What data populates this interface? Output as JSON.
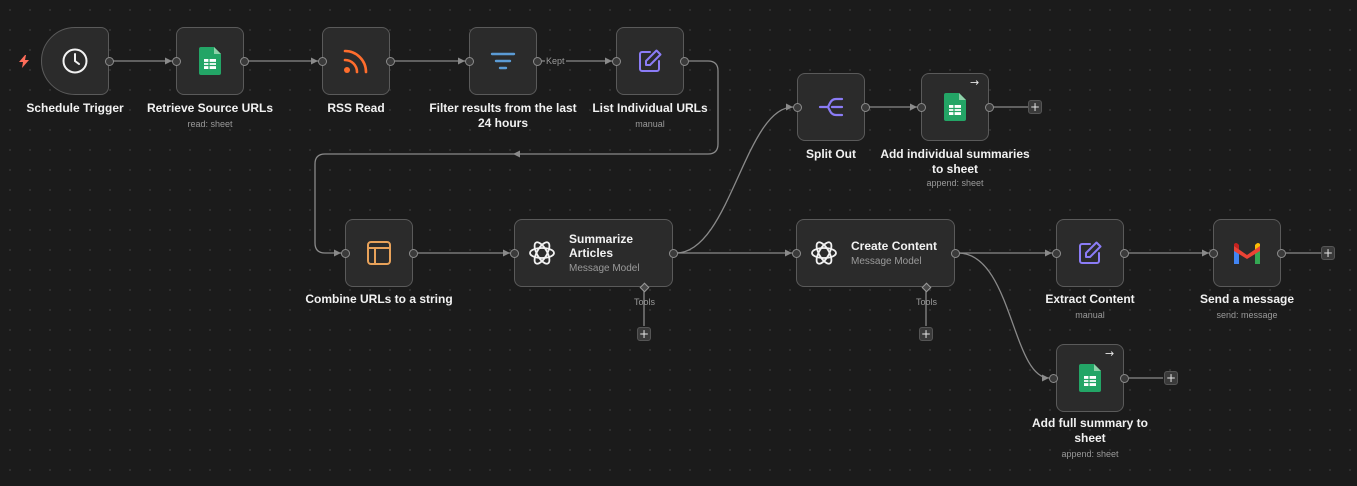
{
  "nodes": {
    "schedule_trigger": {
      "label": "Schedule Trigger",
      "icon": "clock-icon"
    },
    "retrieve_source_urls": {
      "label": "Retrieve Source URLs",
      "sub": "read: sheet",
      "icon": "google-sheets-icon"
    },
    "rss_read": {
      "label": "RSS Read",
      "icon": "rss-icon"
    },
    "filter": {
      "label": "Filter results from the last 24 hours",
      "icon": "filter-icon",
      "output_label": "Kept"
    },
    "list_individual_urls": {
      "label": "List Individual URLs",
      "sub": "manual",
      "icon": "edit-icon"
    },
    "split_out": {
      "label": "Split Out",
      "icon": "split-icon"
    },
    "add_individual_summaries": {
      "label": "Add individual summaries to sheet",
      "sub": "append: sheet",
      "icon": "google-sheets-icon"
    },
    "combine_urls": {
      "label": "Combine URLs to a string",
      "icon": "aggregate-icon"
    },
    "summarize_articles": {
      "title": "Summarize Articles",
      "sub": "Message Model",
      "icon": "openai-icon",
      "tools_label": "Tools"
    },
    "create_content": {
      "title": "Create Content",
      "sub": "Message Model",
      "icon": "openai-icon",
      "tools_label": "Tools"
    },
    "extract_content": {
      "label": "Extract Content",
      "sub": "manual",
      "icon": "edit-icon"
    },
    "send_message": {
      "label": "Send a message",
      "sub": "send: message",
      "icon": "gmail-icon"
    },
    "add_full_summary": {
      "label": "Add full summary to sheet",
      "sub": "append: sheet",
      "icon": "google-sheets-icon"
    }
  },
  "ui": {
    "plus": "+",
    "arrow_badge": "→"
  },
  "colors": {
    "canvas": "#1b1b1b",
    "node_bg": "#2b2b2b",
    "node_border": "#5a5a5a",
    "wire": "#8a8a8a",
    "rss_orange": "#ff6d2d",
    "filter_blue": "#5b9bd5",
    "edit_purple": "#8b7cf6",
    "sheets_green": "#23a566",
    "aggregate_orange": "#e8a25a",
    "trigger_bolt": "#ff6d5a"
  }
}
